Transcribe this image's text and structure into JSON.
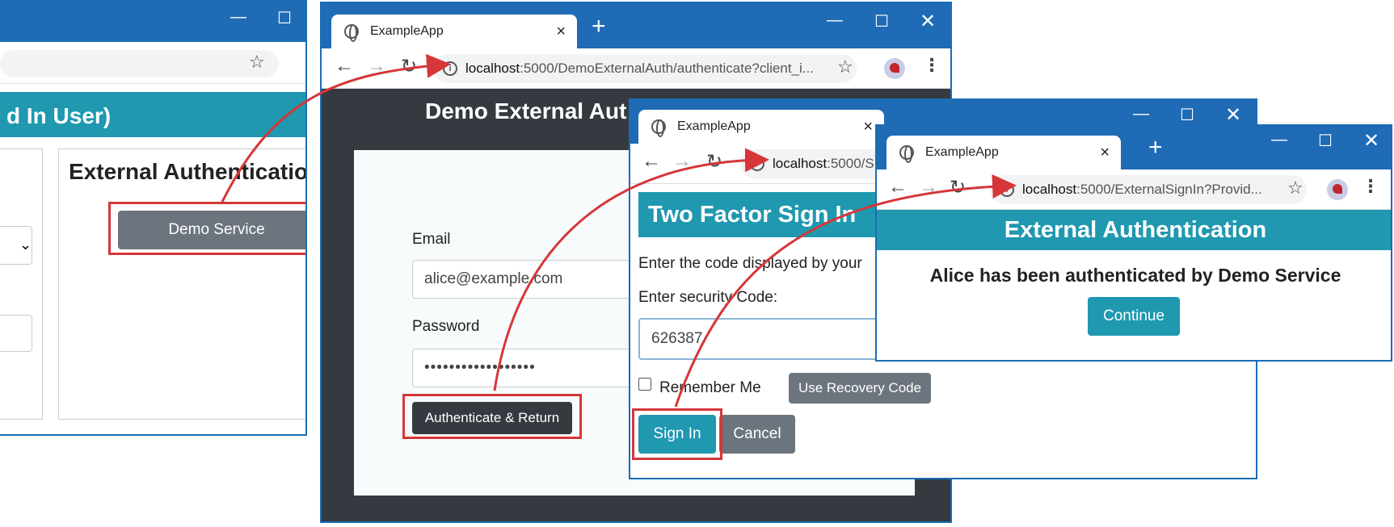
{
  "win1": {
    "header_title": "d In User)",
    "panel_title": "External Authentication",
    "demo_service_button": "Demo Service"
  },
  "win2": {
    "tab_title": "ExampleApp",
    "url_host": "localhost",
    "url_path": ":5000/DemoExternalAuth/authenticate?client_i...",
    "header_title": "Demo External Aut",
    "email_label": "Email",
    "email_value": "alice@example.com",
    "password_label": "Password",
    "password_value": "••••••••••••••••••",
    "submit_button": "Authenticate & Return"
  },
  "win3": {
    "tab_title": "ExampleApp",
    "url_host": "localhost",
    "url_path": ":5000/S",
    "header_title": "Two Factor Sign In",
    "instruction": "Enter the code displayed by your",
    "code_label": "Enter security Code:",
    "code_value": "626387",
    "remember_label": "Remember Me",
    "recovery_button": "Use Recovery Code",
    "sign_in_button": "Sign In",
    "cancel_button": "Cancel"
  },
  "win4": {
    "tab_title": "ExampleApp",
    "url_host": "localhost",
    "url_path": ":5000/ExternalSignIn?Provid...",
    "header_title": "External Authentication",
    "message": "Alice has been authenticated by Demo Service",
    "continue_button": "Continue"
  },
  "icons": [
    "globe-icon",
    "close-icon",
    "new-tab-icon",
    "minimize-icon",
    "maximize-icon",
    "back-icon",
    "forward-icon",
    "reload-icon",
    "info-icon",
    "star-icon",
    "profile-avatar",
    "menu-icon"
  ],
  "colors": {
    "titlebar": "#1f6bb5",
    "header_teal": "#1f98b0",
    "dark_bg": "#343a40",
    "secondary_gray": "#6c757d",
    "highlight_red": "#d63638"
  }
}
